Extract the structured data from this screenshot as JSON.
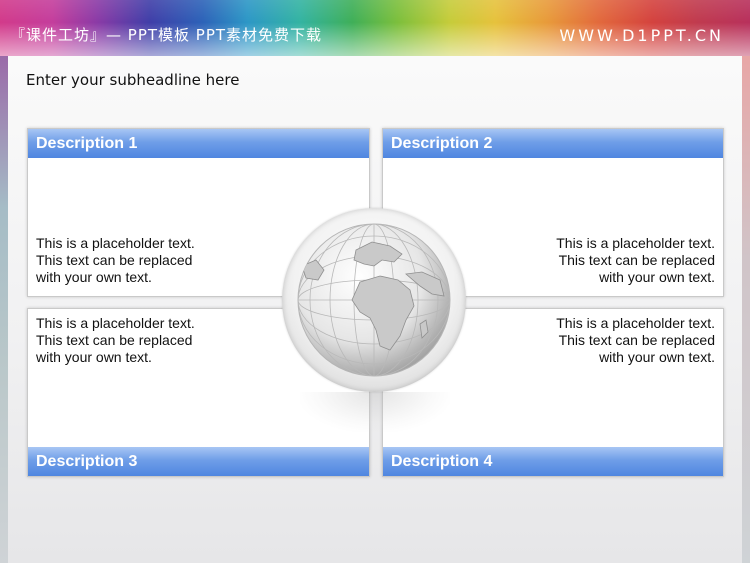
{
  "header": {
    "title": "『课件工坊』— PPT模板 PPT素材免费下载",
    "site": "WWW.D1PPT.CN"
  },
  "slide": {
    "subheadline": "Enter your subheadline here",
    "panels": [
      {
        "title": "Description 1",
        "lines": [
          "This is a placeholder text.",
          "This text can be replaced",
          "with your own text."
        ]
      },
      {
        "title": "Description 2",
        "lines": [
          "This is a placeholder text.",
          "This text can be replaced",
          "with your own text."
        ]
      },
      {
        "title": "Description 3",
        "lines": [
          "This is a placeholder text.",
          "This text can be replaced",
          "with your own text."
        ]
      },
      {
        "title": "Description 4",
        "lines": [
          "This is a placeholder text.",
          "This text can be replaced",
          "with your own text."
        ]
      }
    ],
    "center_icon": "globe-icon"
  },
  "colors": {
    "bar_top": "#a8c6f4",
    "bar_bottom": "#4f86e0"
  }
}
